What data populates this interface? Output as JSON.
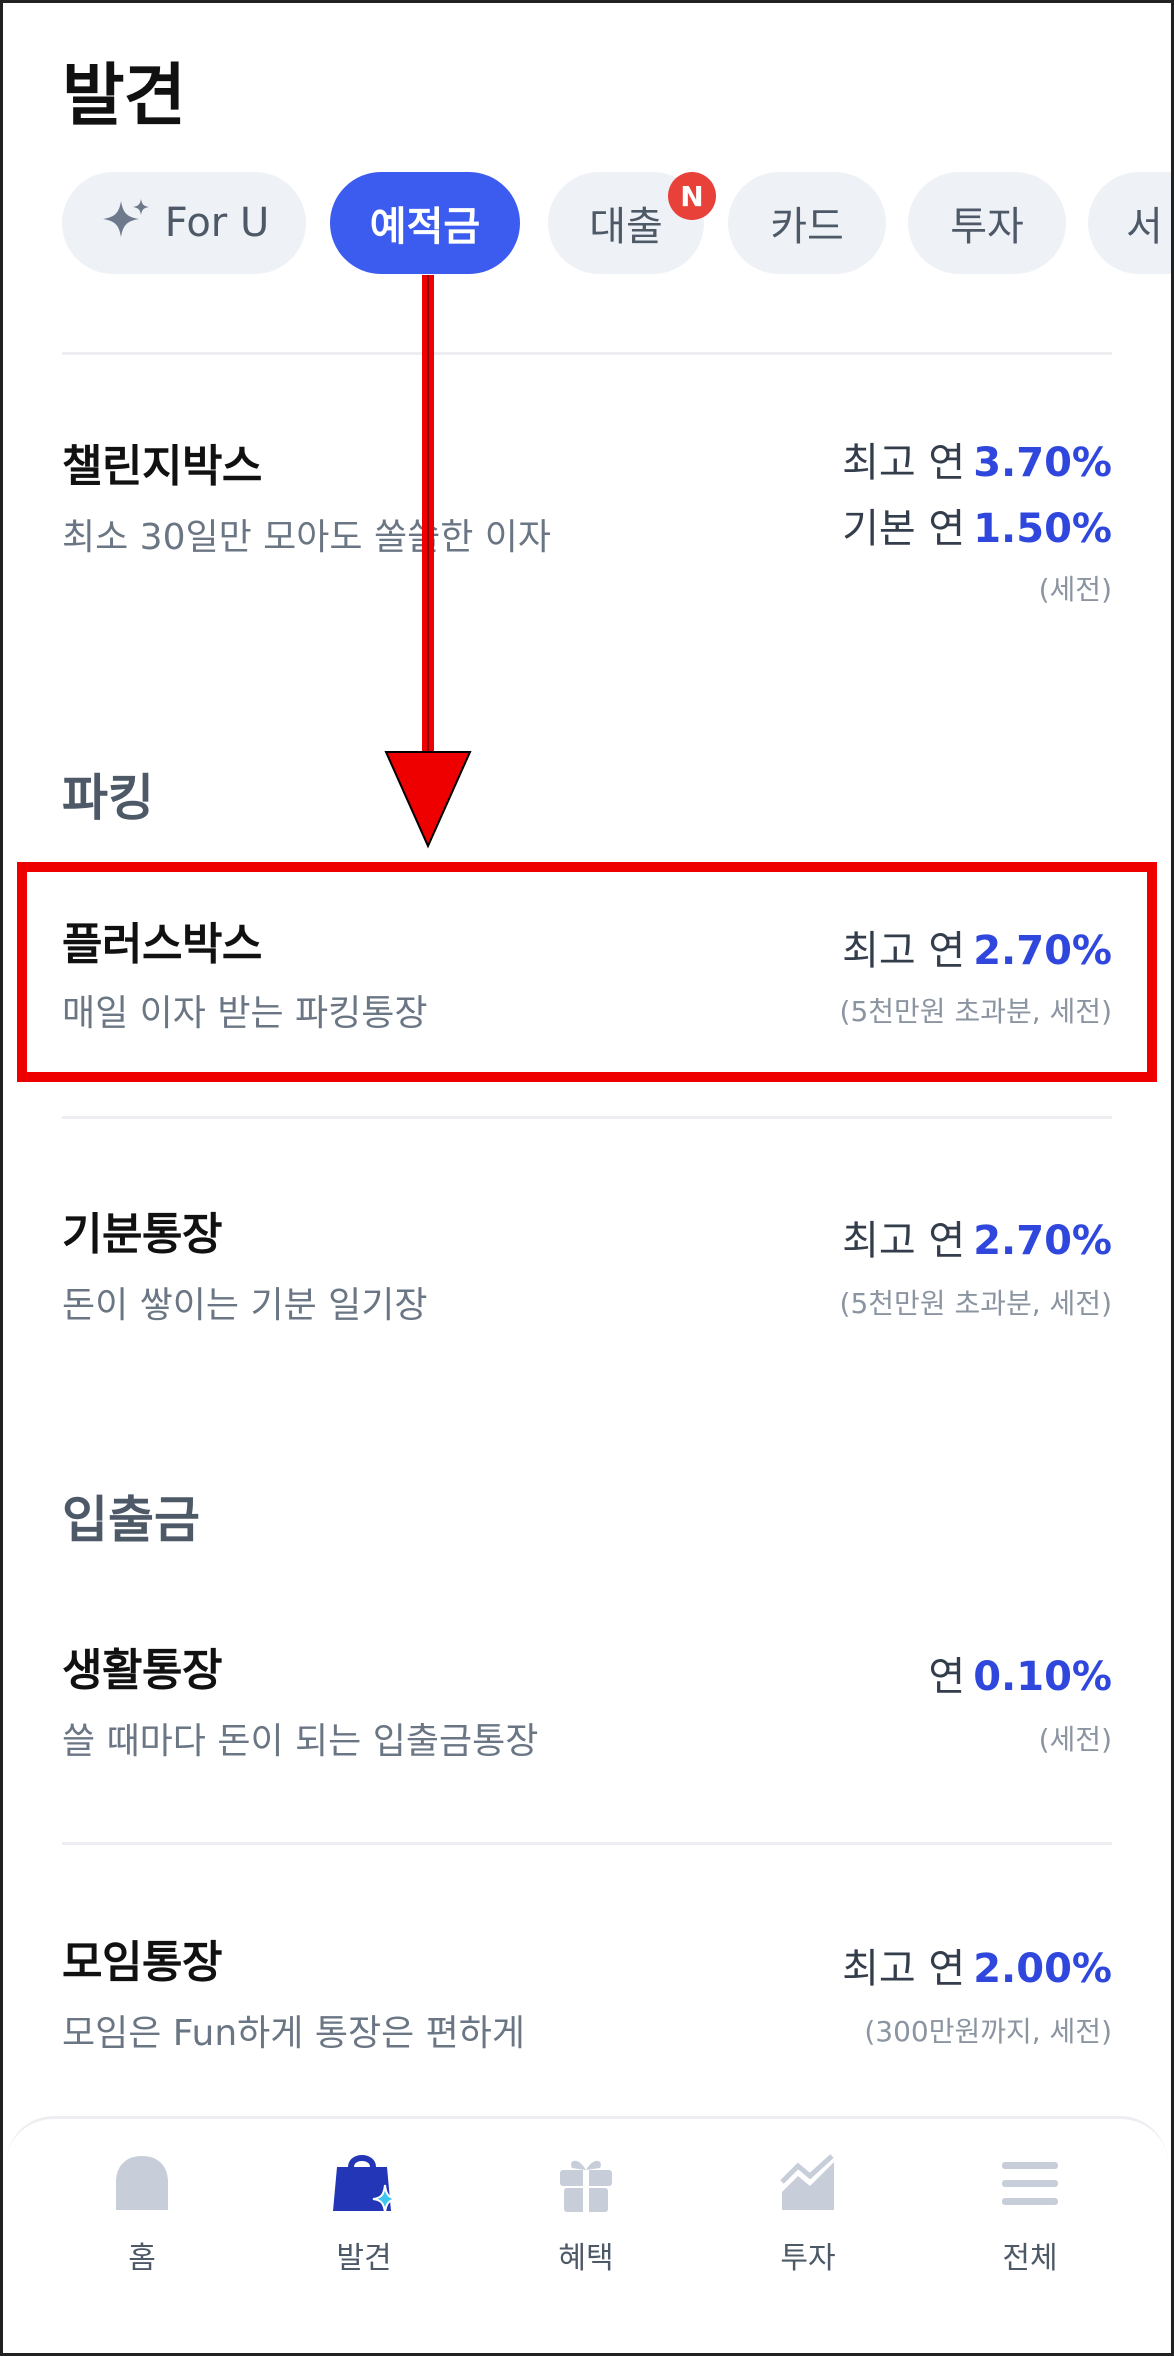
{
  "header": {
    "title": "발견"
  },
  "categories": [
    {
      "label": "For U",
      "icon": "sparkle-icon"
    },
    {
      "label": "예적금",
      "active": true
    },
    {
      "label": "대출",
      "badge": "N"
    },
    {
      "label": "카드"
    },
    {
      "label": "투자"
    },
    {
      "label": "서"
    }
  ],
  "products_top": [
    {
      "name": "챌린지박스",
      "desc": "최소 30일만 모아도 쏠쏠한 이자",
      "rate1_label": "최고 연",
      "rate1_value": "3.70%",
      "rate2_label": "기본 연",
      "rate2_value": "1.50%",
      "note": "(세전)"
    }
  ],
  "sections": {
    "parking": {
      "title": "파킹",
      "items": [
        {
          "name": "플러스박스",
          "desc": "매일 이자 받는 파킹통장",
          "rate_label": "최고 연",
          "rate_value": "2.70%",
          "note": "(5천만원 초과분, 세전)"
        },
        {
          "name": "기분통장",
          "desc": "돈이 쌓이는 기분 일기장",
          "rate_label": "최고 연",
          "rate_value": "2.70%",
          "note": "(5천만원 초과분, 세전)"
        }
      ]
    },
    "deposit": {
      "title": "입출금",
      "items": [
        {
          "name": "생활통장",
          "desc": "쓸 때마다 돈이 되는 입출금통장",
          "rate_label": "연",
          "rate_value": "0.10%",
          "note": "(세전)"
        },
        {
          "name": "모임통장",
          "desc": "모임은 Fun하게 통장은 편하게",
          "rate_label": "최고 연",
          "rate_value": "2.00%",
          "note": "(300만원까지, 세전)"
        }
      ]
    }
  },
  "tabbar": [
    {
      "label": "홈",
      "icon": "home-icon"
    },
    {
      "label": "발견",
      "icon": "shopping-bag-icon",
      "active": true
    },
    {
      "label": "혜택",
      "icon": "gift-icon"
    },
    {
      "label": "투자",
      "icon": "chart-icon"
    },
    {
      "label": "전체",
      "icon": "menu-icon"
    }
  ],
  "colors": {
    "accent": "#3c5cf0",
    "rate": "#2f47dc",
    "annotation": "#ee0000",
    "badge": "#e8413a"
  }
}
